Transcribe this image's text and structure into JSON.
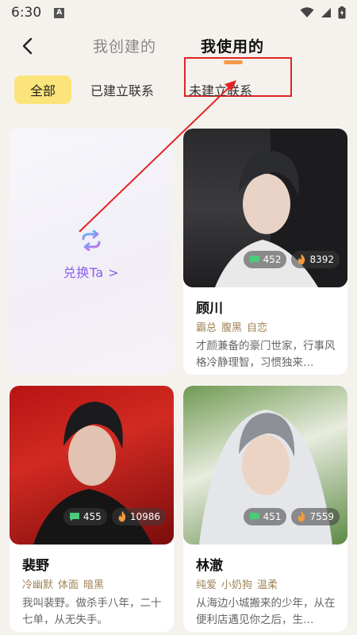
{
  "status_bar": {
    "time": "6:30"
  },
  "header": {
    "tab_created": "我创建的",
    "tab_used": "我使用的"
  },
  "filters": {
    "all": "全部",
    "connected": "已建立联系",
    "unconnected": "未建立联系"
  },
  "exchange": {
    "label": "兑换Ta >"
  },
  "characters": [
    {
      "name": "顾川",
      "tags": [
        "霸总",
        "腹黑",
        "自恋"
      ],
      "desc": "才颜兼备的豪门世家，行事风格冷静理智，习惯独来…",
      "chats": "452",
      "heat": "8392"
    },
    {
      "name": "裴野",
      "tags": [
        "冷幽默",
        "体面",
        "暗黑"
      ],
      "desc": "我叫裴野。做杀手八年，二十七单，从无失手。",
      "chats": "455",
      "heat": "10986"
    },
    {
      "name": "林澈",
      "tags": [
        "纯爱",
        "小奶狗",
        "温柔"
      ],
      "desc": "从海边小城搬来的少年，从在便利店遇见你之后，生…",
      "chats": "451",
      "heat": "7559"
    }
  ],
  "colors": {
    "accent": "#f2994a",
    "chip_active": "#fbe47a",
    "exchange_text": "#8a5cf0",
    "annotation_red": "#e02424"
  }
}
